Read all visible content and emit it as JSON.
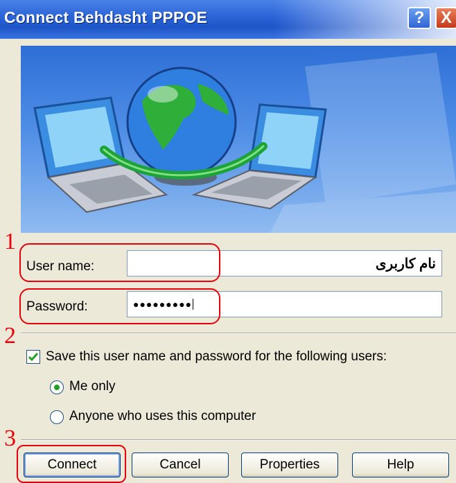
{
  "window": {
    "title": "Connect Behdasht PPPOE",
    "help_glyph": "?",
    "close_glyph": "X"
  },
  "form": {
    "username_label": "User name:",
    "username_value": "نام کاربری",
    "password_label": "Password:",
    "password_value": "●●●●●●●●●",
    "save_checkbox_label": "Save this user name and password for the following users:",
    "save_checked": true,
    "radio_me_only": "Me only",
    "radio_anyone": "Anyone who uses this computer",
    "selected_radio": "Me only"
  },
  "steps": [
    "1",
    "2",
    "3"
  ],
  "buttons": {
    "connect": "Connect",
    "cancel": "Cancel",
    "properties": "Properties",
    "help": "Help"
  },
  "colors": {
    "titlebar": "#2a63d6",
    "annotation_red": "#e8000a",
    "dialog_bg": "#ece9d8"
  }
}
